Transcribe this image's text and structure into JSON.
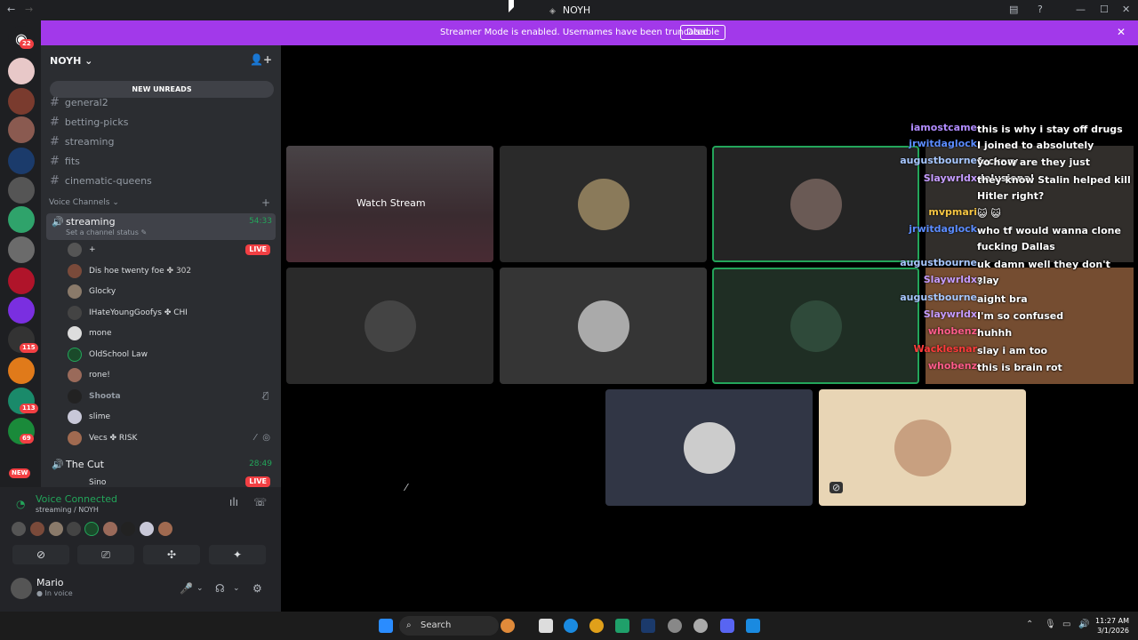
{
  "window": {
    "title": "NOYH"
  },
  "banner": {
    "message": "Streamer Mode is enabled. Usernames have been truncated.",
    "disable_label": "Disable"
  },
  "rail": {
    "home_badge": "22",
    "badges": [
      "115",
      "113",
      "69",
      "NEW"
    ]
  },
  "guild": {
    "name": "NOYH",
    "new_unreads": "NEW UNREADS"
  },
  "channels": {
    "text": [
      "general2",
      "betting-picks",
      "streaming",
      "fits",
      "cinematic-queens"
    ],
    "voice_category": "Voice Channels"
  },
  "voice": {
    "streaming": {
      "name": "streaming",
      "time": "54:33",
      "status": "Set a channel status",
      "users": [
        {
          "name": "+",
          "live": "LIVE"
        },
        {
          "name": "Dis hoe twenty foe",
          "tag": "302"
        },
        {
          "name": "Glocky"
        },
        {
          "name": "IHateYoungGoofys",
          "tag": "CHI"
        },
        {
          "name": "mone"
        },
        {
          "name": "OldSchool Law"
        },
        {
          "name": "rone!"
        },
        {
          "name": "Shoota"
        },
        {
          "name": "slime"
        },
        {
          "name": "Vecs",
          "tag": "RISK"
        }
      ]
    },
    "cut": {
      "name": "The Cut",
      "time": "28:49",
      "users": [
        {
          "name": "Sino",
          "live": "LIVE"
        }
      ]
    }
  },
  "voice_panel": {
    "connected": "Voice Connected",
    "location": "streaming / NOYH"
  },
  "user": {
    "name": "Mario",
    "status": "In voice"
  },
  "stage": {
    "watch_label": "Watch Stream"
  },
  "chat": [
    {
      "user": "iamostcame",
      "msg": "this is why i stay off drugs",
      "color": "#b18cff"
    },
    {
      "user": "jrwitdaglock",
      "msg": "I joined to absolutely fuckery",
      "color": "#5b8cff"
    },
    {
      "user": "augustbourne",
      "msg": "yo how are they just delusional",
      "color": "#a7c7ff"
    },
    {
      "user": "Slaywrldx",
      "msg": "they know Stalin helped kill Hitler right?",
      "color": "#c59cff"
    },
    {
      "user": "mvpmari",
      "msg": "😺 😺",
      "color": "#f5c542"
    },
    {
      "user": "jrwitdaglock",
      "msg": "who tf would wanna clone fucking Dallas",
      "color": "#5b8cff"
    },
    {
      "user": "augustbourne",
      "msg": "uk damn well they don't slay",
      "color": "#a7c7ff"
    },
    {
      "user": "Slaywrldx",
      "msg": "?",
      "color": "#c59cff"
    },
    {
      "user": "augustbourne",
      "msg": "aight bra",
      "color": "#a7c7ff"
    },
    {
      "user": "Slaywrldx",
      "msg": "I'm so confused",
      "color": "#c59cff"
    },
    {
      "user": "whobenz",
      "msg": "huhhh",
      "color": "#ff5c8a"
    },
    {
      "user": "Wacklesnar",
      "msg": "slay i am too",
      "color": "#ff3b3b"
    },
    {
      "user": "whobenz",
      "msg": "this is brain rot",
      "color": "#ff5c8a"
    }
  ],
  "taskbar": {
    "search": "Search",
    "time": "11:27 AM",
    "date": "3/1/2026"
  }
}
